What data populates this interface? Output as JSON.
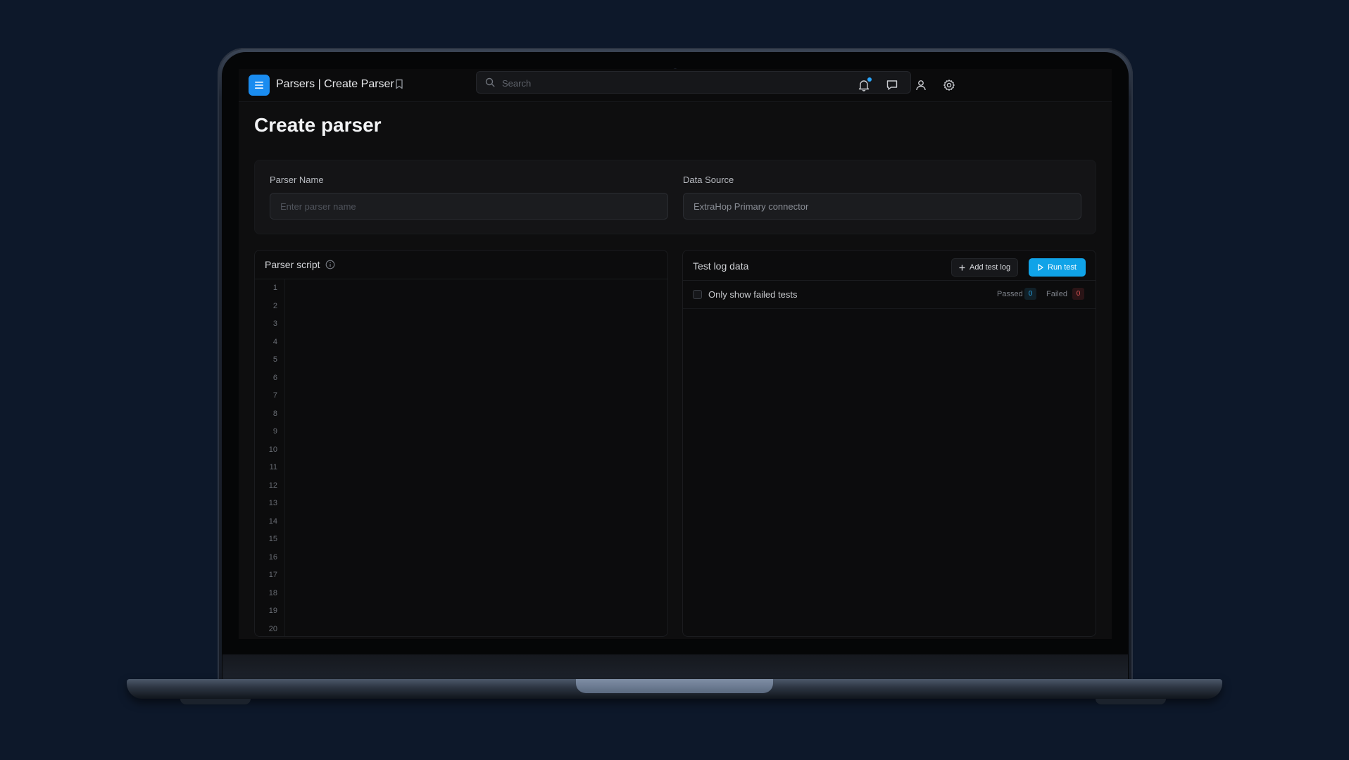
{
  "header": {
    "breadcrumb": "Parsers | Create Parser",
    "search_placeholder": "Search"
  },
  "icons": {
    "menu": "menu-icon",
    "bookmark": "bookmark-icon",
    "search": "search-icon",
    "notifications": "bell-icon",
    "messages": "chat-icon",
    "profile": "user-icon",
    "settings": "gear-icon",
    "info": "info-icon",
    "add": "plus-icon",
    "run": "play-icon"
  },
  "colors": {
    "accent": "#1a8cf0",
    "run_button": "#10a3e8",
    "passed": "#25a3e6",
    "failed": "#e05555"
  },
  "page": {
    "title": "Create parser"
  },
  "form": {
    "parser_name_label": "Parser Name",
    "parser_name_placeholder": "Enter parser name",
    "data_source_label": "Data Source",
    "data_source_value": "ExtraHop Primary connector"
  },
  "script_panel": {
    "title": "Parser script",
    "line_numbers": [
      "1",
      "2",
      "3",
      "4",
      "5",
      "6",
      "7",
      "8",
      "9",
      "10",
      "11",
      "12",
      "13",
      "14",
      "15",
      "16",
      "17",
      "18",
      "19",
      "20"
    ]
  },
  "tests_panel": {
    "title": "Test log data",
    "add_label": "Add test log",
    "run_label": "Run test",
    "filter_label": "Only show failed tests",
    "passed_label": "Passed",
    "passed_count": "0",
    "failed_label": "Failed",
    "failed_count": "0"
  }
}
